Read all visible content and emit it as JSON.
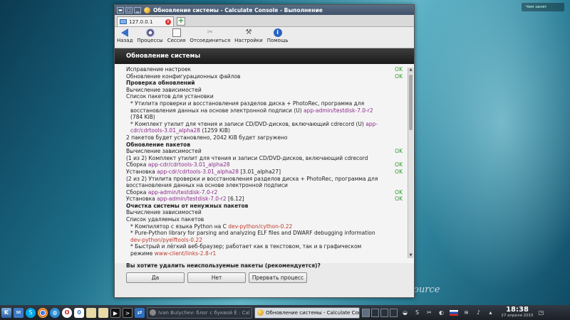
{
  "window": {
    "title": "Обновление системы - Calculate Console - Выполнение",
    "tab": {
      "label": "127.0.0.1",
      "close": "x",
      "add": "+"
    }
  },
  "toolbar": [
    {
      "id": "back",
      "label": "Назад",
      "icon": "back-arrow-icon"
    },
    {
      "id": "processes",
      "label": "Процессы",
      "icon": "gear-disc-icon"
    },
    {
      "id": "session",
      "label": "Сессия",
      "icon": "document-icon"
    },
    {
      "id": "disconnect",
      "label": "Отсоединиться",
      "icon": "disconnect-icon"
    },
    {
      "id": "settings",
      "label": "Настройки",
      "icon": "tools-icon"
    },
    {
      "id": "help",
      "label": "Помощь",
      "icon": "info-icon"
    }
  ],
  "panel": {
    "header": "Обновление системы"
  },
  "log": [
    {
      "text": "Исправление настроек",
      "ok": "OK"
    },
    {
      "text": "Обновление конфигурационных файлов",
      "ok": "OK"
    },
    {
      "text": "Проверка обновлений",
      "bold": true
    },
    {
      "text": "Вычисление зависимостей"
    },
    {
      "text": "Список пакетов для установки"
    },
    {
      "text": "* Утилита проверки и восстановления разделов диска + PhotoRec, программа для восстановления данных на основе электронной подписи (U) ",
      "pkg": "app-admin/testdisk-7.0-r2",
      "after": " (784 KiB)",
      "indent": true
    },
    {
      "text": "* Комплект утилит для чтения и записи CD/DVD-дисков, включающий cdrecord (U) ",
      "pkg": "app-cdr/cdrtools-3.01_alpha28",
      "after": " (1259 KiB)",
      "indent": true
    },
    {
      "text": "2 пакетов будет установлено, 2042 KiB будет загружено"
    },
    {
      "text": "Обновление пакетов",
      "bold": true
    },
    {
      "text": "Вычисление зависимостей",
      "ok": "OK"
    },
    {
      "text": "(1 из 2) Комплект утилит для чтения и записи CD/DVD-дисков, включающий cdrecord"
    },
    {
      "text": "Сборка ",
      "pkg": "app-cdr/cdrtools-3.01_alpha28",
      "ok": "OK"
    },
    {
      "text": "Установка ",
      "pkg": "app-cdr/cdrtools-3.01_alpha28",
      "after": " [3.01_alpha27]",
      "ok": "OK"
    },
    {
      "text": "(2 из 2) Утилита проверки и восстановления разделов диска + PhotoRec, программа для восстановления данных на основе электронной подписи"
    },
    {
      "text": "Сборка ",
      "pkg": "app-admin/testdisk-7.0-r2",
      "ok": "OK"
    },
    {
      "text": "Установка ",
      "pkg": "app-admin/testdisk-7.0-r2",
      "after": " [6.12]",
      "ok": "OK"
    },
    {
      "text": "Очистка системы от ненужных пакетов",
      "bold": true
    },
    {
      "text": "Вычисление зависимостей"
    },
    {
      "text": "Список удаляемых пакетов"
    },
    {
      "text": "* Компилятор с языка Python на C ",
      "pkgRed": "dev-python/cython-0.22",
      "indent": true
    },
    {
      "text": "* Pure-Python library for parsing and analyzing ELF files and DWARF debugging information ",
      "pkgRed": "dev-python/pyelftools-0.22",
      "indent": true
    },
    {
      "text": "* Быстрый и лёгкий веб-браузер; работает как в текстовом, так и в графическом режиме ",
      "pkgRed": "www-client/links-2.8-r1",
      "indent": true
    }
  ],
  "prompt": {
    "question": "Вы хотите удалить неиспользуемые пакеты (рекомендуется)?",
    "yes": "Да",
    "no": "Нет",
    "abort": "Прервать процесс"
  },
  "desktop": {
    "wordmark": "ource",
    "notification": "Чем занят"
  },
  "taskbar": {
    "tasks": [
      {
        "label": "Ivan Bulychev: блог с буквой Ё : Cal",
        "active": false
      },
      {
        "label": "Обновление системы - Calculate Cons",
        "active": true
      }
    ],
    "clock": {
      "time": "18:38",
      "date": "27 апреля 2015"
    }
  },
  "colors": {
    "ok": "#2b9a2b",
    "package": "#8a2b8a",
    "removed_package": "#c0392b",
    "header_bg": "#1a1a1a"
  }
}
